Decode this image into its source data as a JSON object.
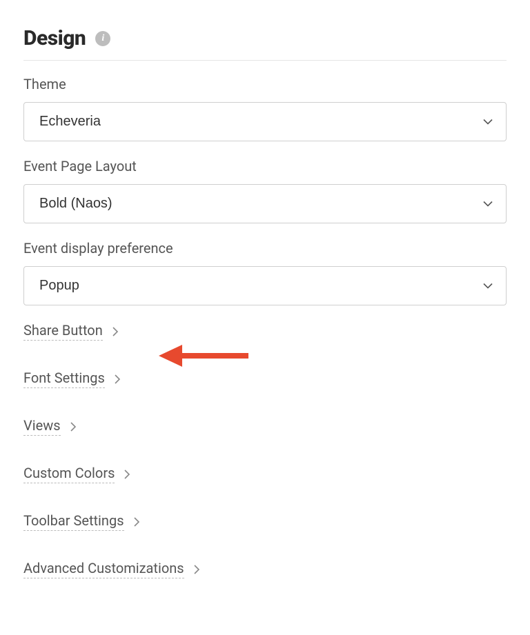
{
  "header": {
    "title": "Design",
    "info_glyph": "i"
  },
  "fields": {
    "theme": {
      "label": "Theme",
      "value": "Echeveria"
    },
    "layout": {
      "label": "Event Page Layout",
      "value": "Bold (Naos)"
    },
    "display": {
      "label": "Event display preference",
      "value": "Popup"
    }
  },
  "links": {
    "share": "Share Button",
    "font": "Font Settings",
    "views": "Views",
    "colors": "Custom Colors",
    "toolbar": "Toolbar Settings",
    "advanced": "Advanced Customizations"
  },
  "annotation": {
    "arrow_color": "#e7492e"
  }
}
